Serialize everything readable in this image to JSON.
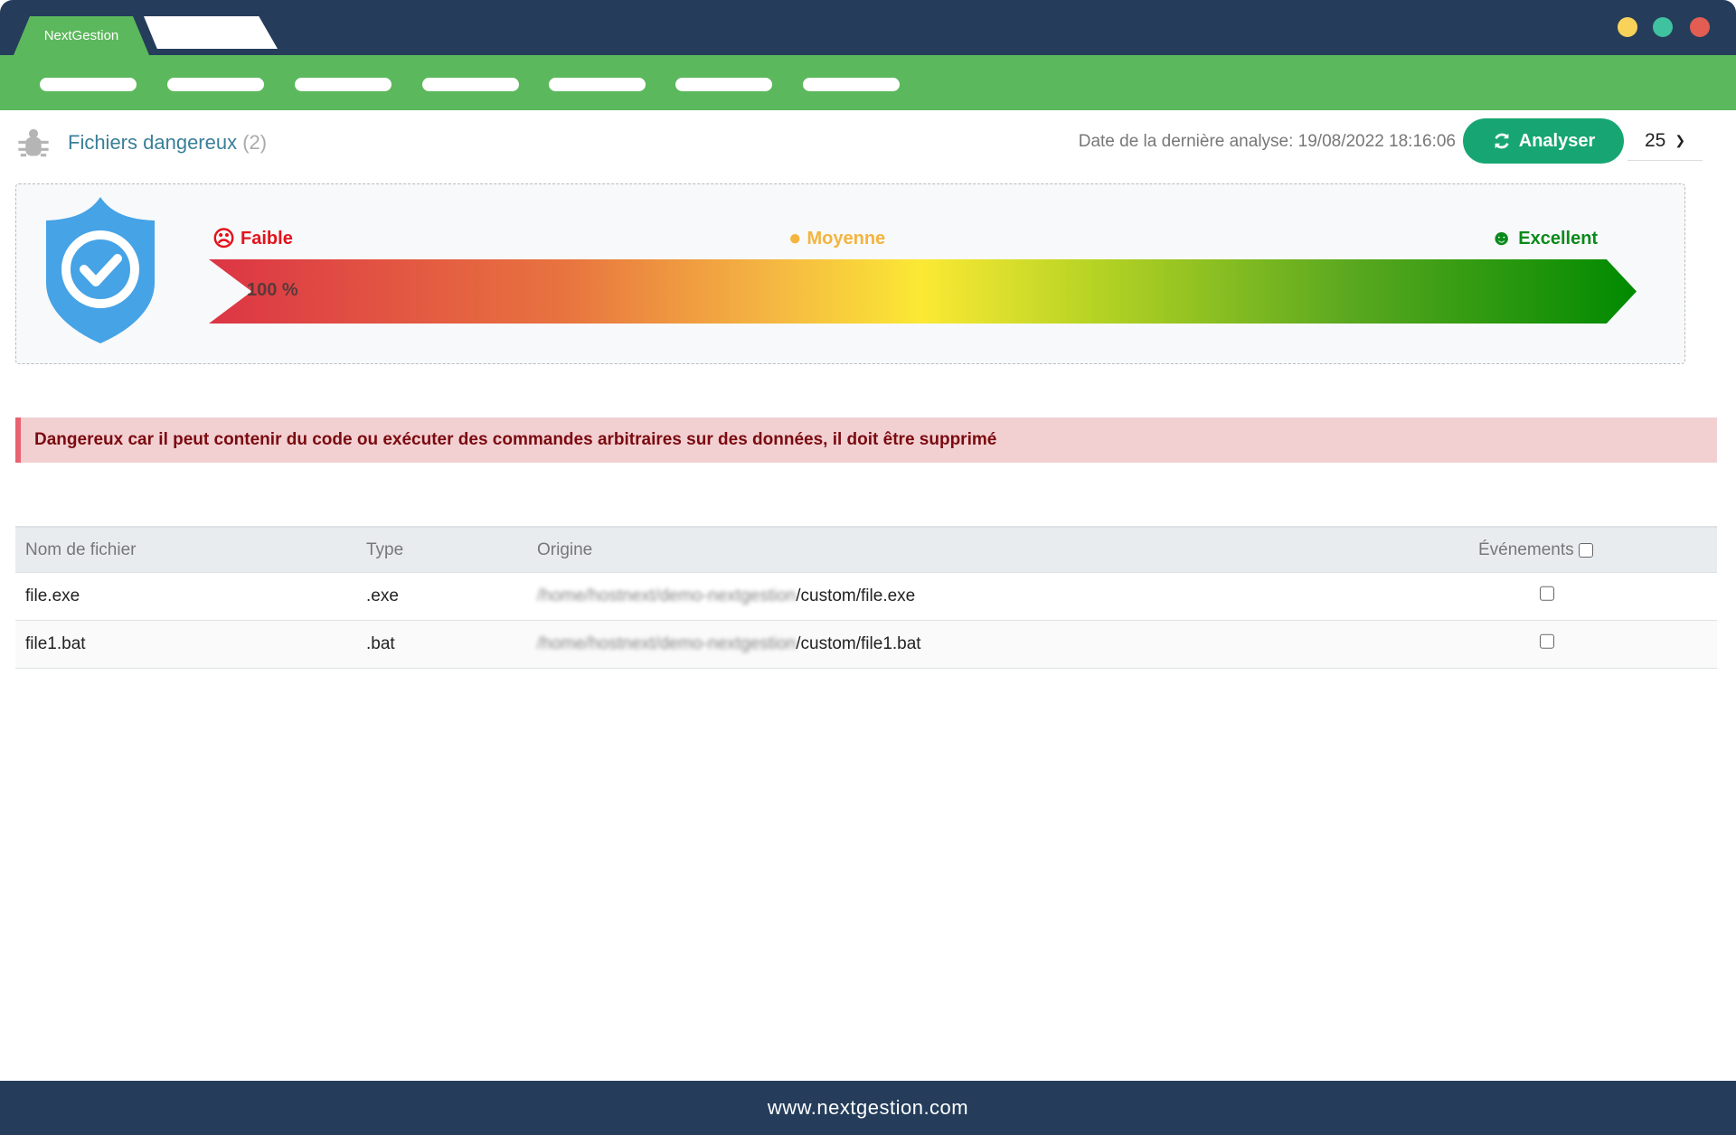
{
  "window": {
    "tab_active": "NextGestion",
    "dots": [
      "#f9d25a",
      "#3fc2a0",
      "#e35d52"
    ]
  },
  "page": {
    "title": "Fichiers dangereux",
    "count": "(2)",
    "last_analysis": "Date de la dernière analyse: 19/08/2022 18:16:06",
    "analyse_label": "Analyser",
    "per_page": "25"
  },
  "score": {
    "levels": {
      "low": "Faible",
      "mid": "Moyenne",
      "high": "Excellent"
    },
    "percent_label": "100 %",
    "colors": {
      "low": "#e3131b",
      "mid": "#f4b43e",
      "high": "#0a8a1a"
    }
  },
  "alert": "Dangereux car il peut contenir du code ou exécuter des commandes arbitraires sur des données, il doit être supprimé",
  "table": {
    "headers": [
      "Nom de fichier",
      "Type",
      "Origine",
      "Événements"
    ],
    "rows": [
      {
        "name": "file.exe",
        "type": ".exe",
        "origin_hidden": "/home/hostnext/demo-nextgestion",
        "origin": "/custom/file.exe"
      },
      {
        "name": "file1.bat",
        "type": ".bat",
        "origin_hidden": "/home/hostnext/demo-nextgestion",
        "origin": "/custom/file1.bat"
      }
    ]
  },
  "footer": "www.nextgestion.com"
}
